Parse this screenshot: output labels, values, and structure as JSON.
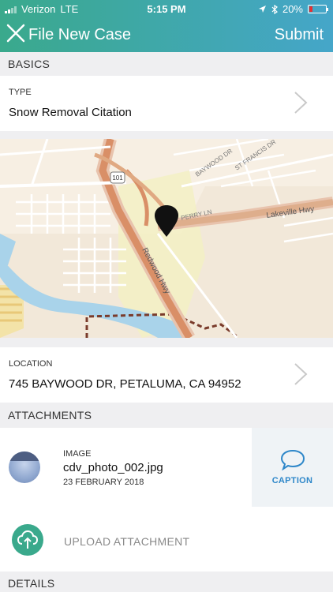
{
  "status_bar": {
    "carrier": "Verizon",
    "network": "LTE",
    "time": "5:15 PM",
    "battery": "20%",
    "battery_level": 0.2
  },
  "nav": {
    "title": "File New Case",
    "submit_label": "Submit"
  },
  "basics": {
    "header": "BASICS",
    "type_label": "TYPE",
    "type_value": "Snow Removal Citation"
  },
  "map": {
    "labels": [
      "Redwood Hwy",
      "Lakeville Hwy",
      "BAYWOOD DR",
      "PERRY LN",
      "ST FRANCIS DR",
      "101"
    ]
  },
  "location": {
    "label": "LOCATION",
    "value": "745 BAYWOOD DR, PETALUMA, CA 94952"
  },
  "attachments": {
    "header": "ATTACHMENTS",
    "items": [
      {
        "type": "IMAGE",
        "name": "cdv_photo_002.jpg",
        "date": "23 FEBRUARY 2018",
        "caption_label": "CAPTION"
      }
    ],
    "upload_label": "UPLOAD ATTACHMENT"
  },
  "details": {
    "header": "DETAILS"
  },
  "colors": {
    "header_start": "#3aa98c",
    "header_end": "#45a6c9",
    "accent_blue": "#2e87c9",
    "upload_green": "#3aa98c"
  }
}
